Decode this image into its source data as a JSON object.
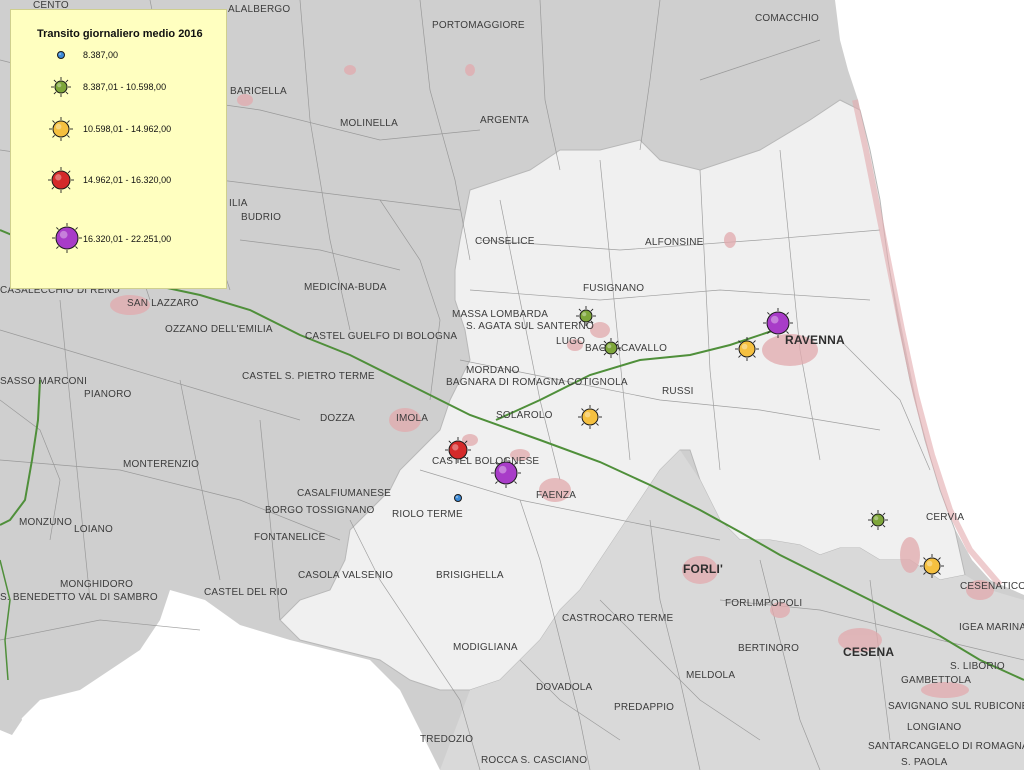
{
  "legend": {
    "title": "Transito giornaliero medio 2016",
    "classes": [
      {
        "label": "8.387,00",
        "color": "#3b8ad8",
        "icon": "small-blue-marker-icon"
      },
      {
        "label": "8.387,01 - 10.598,00",
        "color": "#7ea63a",
        "icon": "green-marker-icon"
      },
      {
        "label": "10.598,01 - 14.962,00",
        "color": "#f5c040",
        "icon": "yellow-marker-icon"
      },
      {
        "label": "14.962,01 - 16.320,00",
        "color": "#d42a2a",
        "icon": "red-marker-icon"
      },
      {
        "label": "16.320,01 - 22.251,00",
        "color": "#a83cc8",
        "icon": "purple-marker-icon"
      }
    ]
  },
  "colors": {
    "sea": "#ffffff",
    "outer_area": "#cfcfcf",
    "province_area": "#f0f0f0",
    "urban": "#e2aaad",
    "roads": "#8c8c8c",
    "railway": "#4f8f3a"
  },
  "places": {
    "alalbergo": "ALALBERGO",
    "cento": "CENTO",
    "portomaggiore": "PORTOMAGGIORE",
    "comacchio": "COMACCHIO",
    "baricella": "BARICELLA",
    "molinella": "MOLINELLA",
    "argenta": "ARGENTA",
    "ilia": "ILIA",
    "budrio": "BUDRIO",
    "conselice": "CONSELICE",
    "alfonsine": "ALFONSINE",
    "fusignano": "FUSIGNANO",
    "medicina_buda": "MEDICINA-BUDA",
    "casalecchio": "CASALECCHIO DI RENO",
    "san_lazzaro": "SAN LAZZARO",
    "massa_lombarda": "MASSA LOMBARDA",
    "sagata": "S. AGATA SUL SANTERNO",
    "ozzano": "OZZANO DELL'EMILIA",
    "castel_guelfo": "CASTEL GUELFO DI BOLOGNA",
    "lugo": "LUGO",
    "bagnacavallo": "BAGNACAVALLO",
    "ravenna": "RAVENNA",
    "sasso_marconi": "SASSO MARCONI",
    "castel_s_pietro": "CASTEL S. PIETRO TERME",
    "mordano": "MORDANO",
    "bagnara": "BAGNARA DI ROMAGNA",
    "cotignola": "COTIGNOLA",
    "pianoro": "PIANORO",
    "russi": "RUSSI",
    "dozza": "DOZZA",
    "imola": "IMOLA",
    "solarolo": "SOLAROLO",
    "monterenzio": "MONTERENZIO",
    "castel_bolognese": "CASTEL BOLOGNESE",
    "casalfiumanese": "CASALFIUMANESE",
    "faenza": "FAENZA",
    "monzuno": "MONZUNO",
    "loiano": "LOIANO",
    "borgo_tossignano": "BORGO TOSSIGNANO",
    "riolo_terme": "RIOLO TERME",
    "cervia": "CERVIA",
    "fontanelice": "FONTANELICE",
    "casola_valsenio": "CASOLA VALSENIO",
    "brisighella": "BRISIGHELLA",
    "forli": "FORLI'",
    "cesenatico": "CESENATICO",
    "monghidoro": "MONGHIDORO",
    "castel_del_rio": "CASTEL DEL RIO",
    "s_benedetto": "S. BENEDETTO VAL DI SAMBRO",
    "forlimpopoli": "FORLIMPOPOLI",
    "castrocaro": "CASTROCARO TERME",
    "igea_marina": "IGEA MARINA",
    "modigliana": "MODIGLIANA",
    "bertinoro": "BERTINORO",
    "cesena": "CESENA",
    "s_liborio": "S. LIBORIO",
    "meldola": "MELDOLA",
    "gambettola": "GAMBETTOLA",
    "dovadola": "DOVADOLA",
    "savignano": "SAVIGNANO SUL RUBICONE",
    "predappio": "PREDAPPIO",
    "longiano": "LONGIANO",
    "tredozio": "TREDOZIO",
    "santarcangelo": "SANTARCANGELO DI ROMAGNA",
    "rocca_s_casciano": "ROCCA S. CASCIANO",
    "s_paola": "S. PAOLA"
  },
  "stations": [
    {
      "name": "riolo-terme-station",
      "class": 0
    },
    {
      "name": "massa-lombarda-station",
      "class": 1
    },
    {
      "name": "bagnacavallo-station",
      "class": 1
    },
    {
      "name": "cervia-north-station",
      "class": 1
    },
    {
      "name": "ravenna-south-station",
      "class": 2
    },
    {
      "name": "cotignola-station",
      "class": 2
    },
    {
      "name": "cervia-south-station",
      "class": 2
    },
    {
      "name": "castel-bolognese-west-station",
      "class": 3
    },
    {
      "name": "ravenna-station",
      "class": 4
    },
    {
      "name": "castel-bolognese-station",
      "class": 4
    }
  ]
}
